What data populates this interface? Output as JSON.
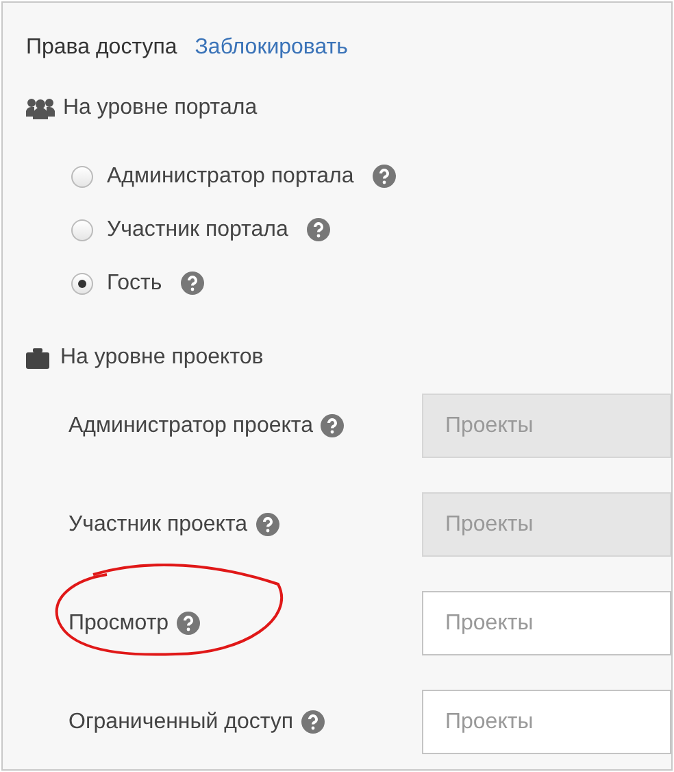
{
  "header": {
    "title": "Права доступа",
    "link": "Заблокировать"
  },
  "portal_level": {
    "heading": "На уровне портала",
    "roles": [
      {
        "label": "Администратор портала",
        "selected": false
      },
      {
        "label": "Участник портала",
        "selected": false
      },
      {
        "label": "Гость",
        "selected": true
      }
    ]
  },
  "project_level": {
    "heading": "На уровне проектов",
    "roles": [
      {
        "label": "Администратор проекта",
        "placeholder": "Проекты",
        "disabled": true,
        "circled": false
      },
      {
        "label": "Участник проекта",
        "placeholder": "Проекты",
        "disabled": true,
        "circled": false
      },
      {
        "label": "Просмотр",
        "placeholder": "Проекты",
        "disabled": false,
        "circled": true
      },
      {
        "label": "Ограниченный доступ",
        "placeholder": "Проекты",
        "disabled": false,
        "circled": false
      }
    ]
  }
}
